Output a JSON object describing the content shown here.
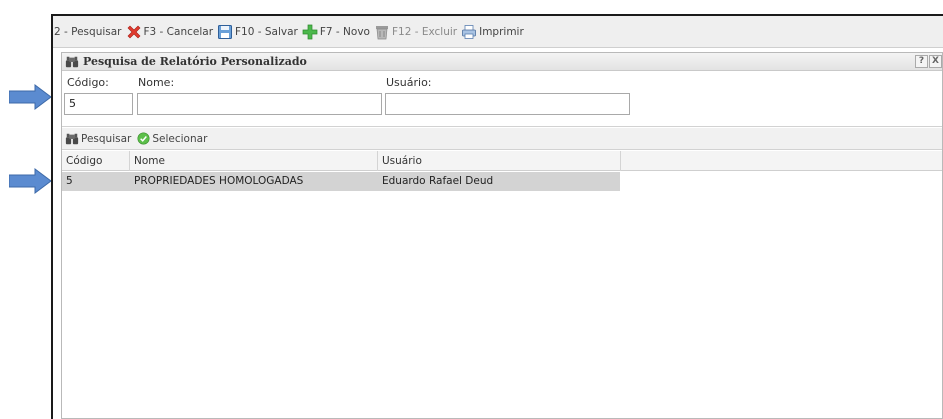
{
  "toolbar": {
    "items": [
      {
        "label": "2 - Pesquisar",
        "icon": "none"
      },
      {
        "label": "F3 - Cancelar",
        "icon": "cancel-x-icon"
      },
      {
        "label": "F10 - Salvar",
        "icon": "save-floppy-icon"
      },
      {
        "label": "F7 - Novo",
        "icon": "plus-icon"
      },
      {
        "label": "F12 - Excluir",
        "icon": "trash-icon"
      },
      {
        "label": "Imprimir",
        "icon": "printer-icon"
      }
    ]
  },
  "dialog": {
    "title": "Pesquisa de Relatório Personalizado",
    "help_label": "?",
    "close_label": "X"
  },
  "filters": {
    "codigo_label": "Código:",
    "codigo_value": "5",
    "nome_label": "Nome:",
    "nome_value": "",
    "usuario_label": "Usuário:",
    "usuario_value": ""
  },
  "grid_toolbar": {
    "search_label": "Pesquisar",
    "select_label": "Selecionar"
  },
  "grid": {
    "columns": [
      "Código",
      "Nome",
      "Usuário"
    ],
    "rows": [
      [
        "5",
        "PROPRIEDADES HOMOLOGADAS",
        "Eduardo Rafael Deud"
      ]
    ]
  },
  "colors": {
    "arrow": "#4f81bd",
    "selected_row": "#d3d3d3",
    "cancel_red": "#e03a2e",
    "add_green": "#4cb84c"
  }
}
